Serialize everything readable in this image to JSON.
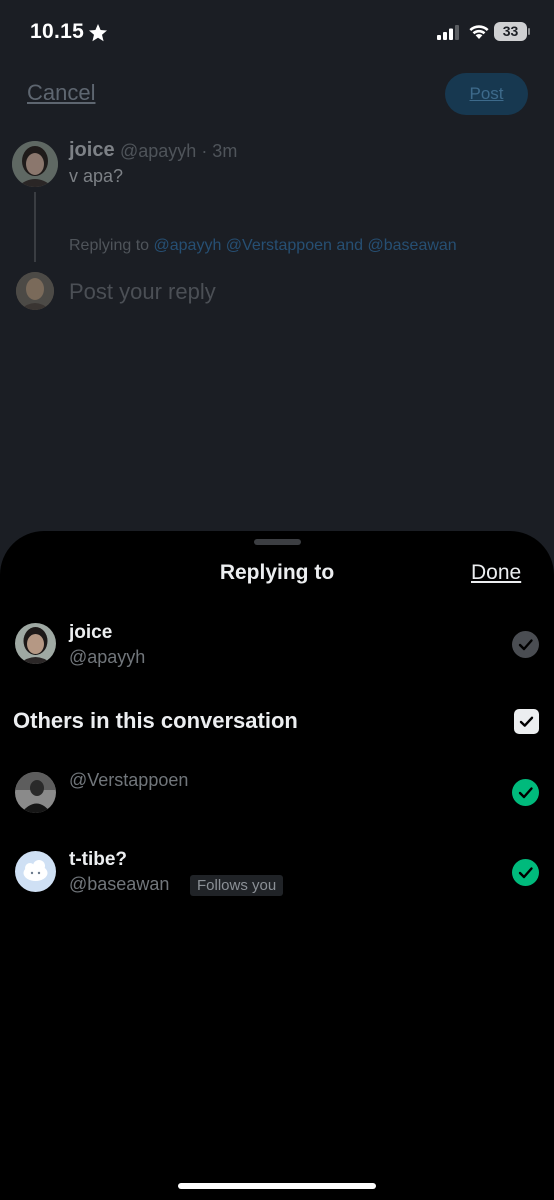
{
  "status_bar": {
    "time": "10.15",
    "battery": "33"
  },
  "compose": {
    "cancel_label": "Cancel",
    "post_label": "Post",
    "original_post": {
      "name": "joice",
      "meta": "@apayyh · 3m",
      "text": "v apa?"
    },
    "replying_prefix": "Replying to",
    "replying_mentions": [
      "@apayyh",
      "@Verstappoen",
      "and",
      "@baseawan"
    ],
    "reply_placeholder": "Post your reply"
  },
  "sheet": {
    "title": "Replying to",
    "done_label": "Done",
    "primary_user": {
      "name": "joice",
      "handle": "@apayyh",
      "checked": true
    },
    "others_title": "Others in this conversation",
    "others_all_checked": true,
    "others": [
      {
        "name": "",
        "handle": "@Verstappoen",
        "badge": "",
        "checked": true
      },
      {
        "name": "t-tibe?",
        "handle": "@baseawan",
        "badge": "Follows you",
        "checked": true
      }
    ]
  },
  "colors": {
    "accent_green": "#00ba7c",
    "link_blue": "#1d9bf0",
    "sheet_bg": "#000000"
  }
}
